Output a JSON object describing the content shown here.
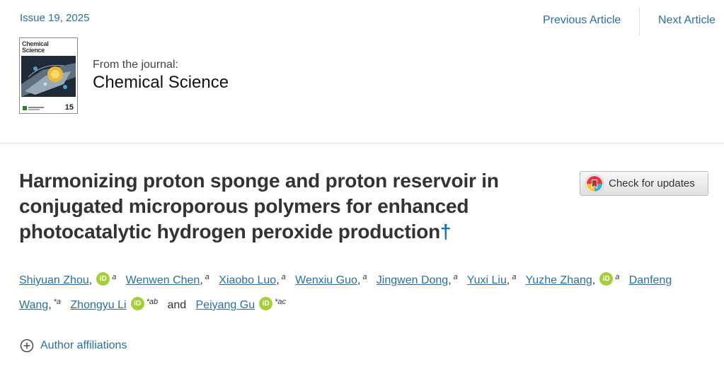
{
  "header": {
    "issue": "Issue 19, 2025",
    "prev_label": "Previous Article",
    "next_label": "Next Article"
  },
  "journal": {
    "cover_title_line1": "Chemical",
    "cover_title_line2": "Science",
    "cover_issue_number": "15",
    "from_label": "From the journal:",
    "name": "Chemical Science"
  },
  "article": {
    "title_line1": "Harmonizing proton sponge and proton reservoir in",
    "title_line2": "conjugated microporous polymers for enhanced",
    "title_line3": "photocatalytic hydrogen peroxide production",
    "dagger": "†",
    "check_updates_label": "Check for updates"
  },
  "authors": {
    "list": [
      {
        "name": "Shiyuan Zhou",
        "aff": "a"
      },
      {
        "name": "Wenwen Chen",
        "aff": "a"
      },
      {
        "name": "Xiaobo Luo",
        "aff": "a"
      },
      {
        "name": "Wenxiu Guo",
        "aff": "a"
      },
      {
        "name": "Jingwen Dong",
        "aff": "a"
      },
      {
        "name": "Yuxi Liu",
        "aff": "a"
      },
      {
        "name": "Yuzhe Zhang",
        "aff": "a"
      },
      {
        "name_part1": "Danfeng",
        "name_part2": "Wang",
        "aff": "*a"
      },
      {
        "name": "Zhongyu Li",
        "aff": "*ab"
      },
      {
        "name": "Peiyang Gu",
        "aff": "*ac"
      }
    ],
    "and_word": "and",
    "orcid_label": "iD",
    "affiliations_label": "Author affiliations"
  },
  "colors": {
    "link": "#2c6e9e",
    "orcid": "#a6ce39",
    "dagger": "#1a74b0"
  },
  "icons": [
    "crossmark-icon",
    "orcid-icon",
    "plus-circle-icon"
  ]
}
